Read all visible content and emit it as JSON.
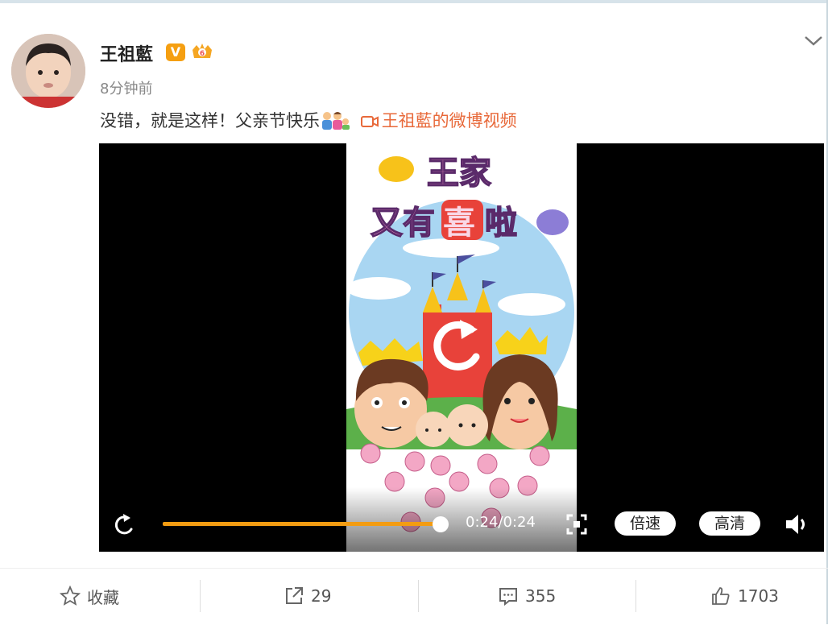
{
  "post": {
    "username": "王祖藍",
    "verified_badge": "V",
    "time": "8分钟前",
    "text": "没错，就是这样！父亲节快乐",
    "video_link": "王祖藍的微博视频"
  },
  "video": {
    "title_line1": "王家",
    "title_line2_a": "又有",
    "title_line2_highlight": "喜",
    "title_line2_b": "啦",
    "timecode": "0:24/0:24",
    "progress": 1.0,
    "speed_label": "倍速",
    "quality_label": "高清"
  },
  "actions": {
    "favorite": "收藏",
    "repost": "29",
    "comment": "355",
    "like": "1703"
  },
  "colors": {
    "accent_orange": "#f39c12",
    "link": "#e8693a",
    "verified": "#f59f11"
  },
  "icons": [
    "chevron-down-icon",
    "camera-icon",
    "replay-icon",
    "fullscreen-icon",
    "volume-icon",
    "star-icon",
    "share-icon",
    "comment-icon",
    "thumbs-up-icon"
  ]
}
